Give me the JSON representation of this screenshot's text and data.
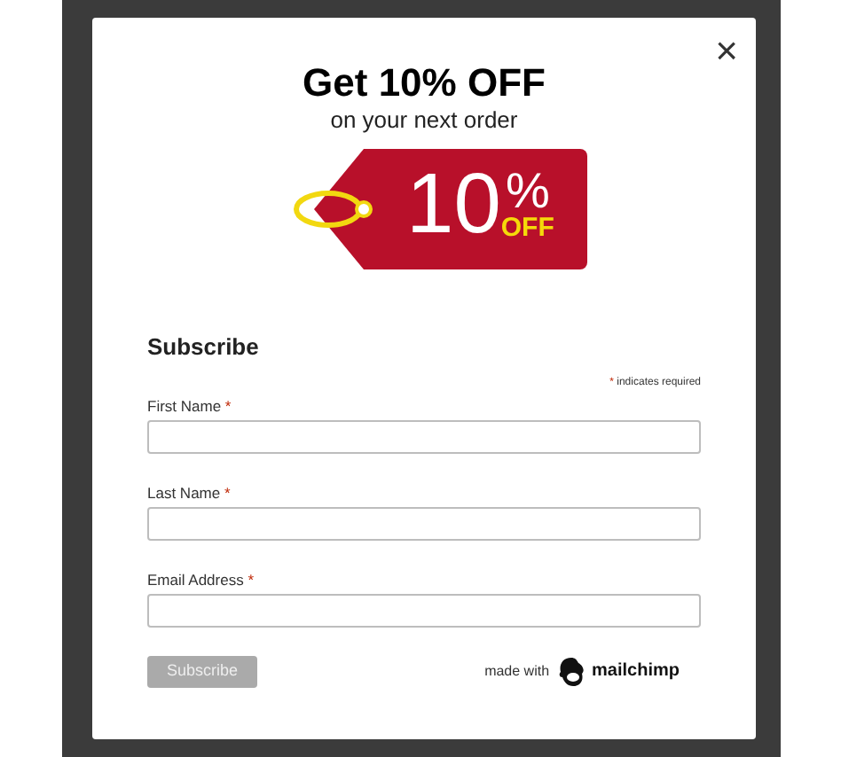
{
  "popup": {
    "title": "Get 10% OFF",
    "subtitle": "on your next order",
    "close": "×",
    "tag": {
      "number": "10",
      "percent": "%",
      "off": "OFF"
    },
    "form": {
      "heading": "Subscribe",
      "required_note": {
        "mark": "*",
        "text": "indicates required"
      },
      "fields": [
        {
          "label": "First Name",
          "mark": "*"
        },
        {
          "label": "Last Name",
          "mark": "*"
        },
        {
          "label": "Email Address",
          "mark": "*"
        }
      ],
      "submit": {
        "label": "Subscribe",
        "disabled": true
      },
      "credit": {
        "text": "made with",
        "brand": "mailchimp"
      }
    }
  }
}
